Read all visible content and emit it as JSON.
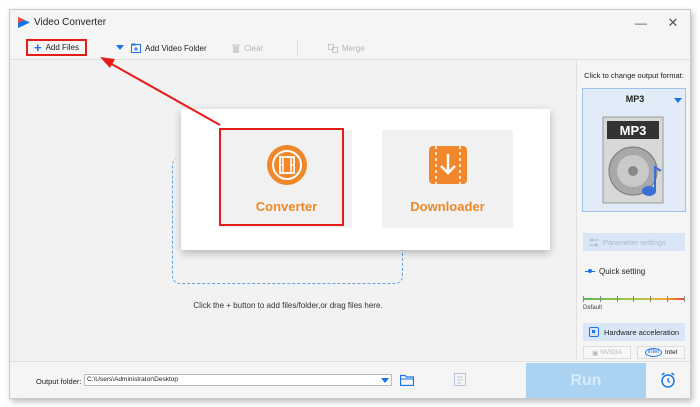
{
  "window": {
    "title": "Video Converter",
    "minimize": "—",
    "close": "✕"
  },
  "toolbar": {
    "add_files": "Add Files",
    "add_video_folder": "Add Video Folder",
    "clear": "Clear",
    "merge": "Merge"
  },
  "popup": {
    "converter_label": "Converter",
    "downloader_label": "Downloader"
  },
  "main": {
    "drop_hint": "Click the + button to add files/folder,or drag files here."
  },
  "right_panel": {
    "format_hint": "Click to change output format:",
    "format_name": "MP3",
    "format_icon_text": "MP3",
    "parameter_settings": "Parameter settings",
    "quick_setting": "Quick setting",
    "default_label": "Default",
    "hardware_acceleration": "Hardware acceleration",
    "nvidia": "NVIDIA",
    "intel": "Intel",
    "intel_logo": "intel"
  },
  "bottom": {
    "output_folder_label": "Output folder:",
    "output_folder_value": "C:\\Users\\Administrator\\Desktop",
    "run": "Run"
  },
  "colors": {
    "accent_blue": "#1a73e8",
    "highlight_red": "#e31b1b",
    "mode_orange": "#f0882b"
  }
}
